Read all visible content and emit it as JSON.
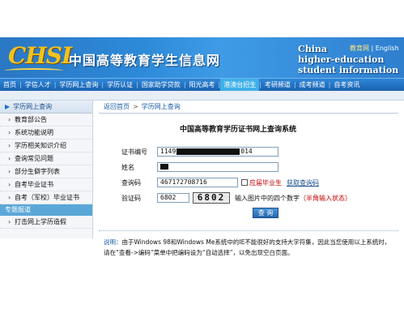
{
  "header": {
    "logo_text": "CHSI",
    "site_title": "中国高等教育学生信息网",
    "english_title": [
      "China",
      "higher-education",
      "student information"
    ],
    "top_links": {
      "first": "教育网",
      "sep": " | ",
      "second": "English"
    }
  },
  "nav": {
    "items": [
      "首页",
      "学信人才",
      "学历网上查询",
      "学历认证",
      "国家助学贷款",
      "阳光高考",
      "港澳台招生",
      "考研频道",
      "成考频道",
      "自考资讯"
    ],
    "active_index": 6
  },
  "sidebar": {
    "head": "学历网上查询",
    "items": [
      "教育部公告",
      "系统功能说明",
      "学历相关知识介绍",
      "查询常见问题",
      "部分生僻字列表",
      "自考毕业证书",
      "自考（军校）毕业证书"
    ],
    "section": "专题报道",
    "section_items": [
      "打击网上学历造假"
    ]
  },
  "breadcrumb": {
    "home": "返回首页",
    "gt": ">",
    "current": "学历网上查询"
  },
  "form": {
    "title": "中国高等教育学历证书网上查询系统",
    "cert_label": "证书编号",
    "cert_prefix": "1149",
    "cert_suffix": "014",
    "name_label": "姓名",
    "query_code_label": "查询码",
    "query_code_value": "467172708716",
    "graduate_checkbox_label": "应届毕业生",
    "get_code_link": "获取查询码",
    "captcha_label": "验证码",
    "captcha_input": "6802",
    "captcha_image": "6802",
    "captcha_hint": "输入图片中的四个数字",
    "captcha_hint_red": "（半角输入状态）",
    "submit": "查 询"
  },
  "note": {
    "label": "说明：",
    "line1": "由于Windows 98和Windows Me系统中的IE不能很好的支持大字符集，因此当您使用以上系统时，",
    "line2": "请在“查看->编码”菜单中把编码设为“自动选择”，以免出现空白页面。"
  }
}
